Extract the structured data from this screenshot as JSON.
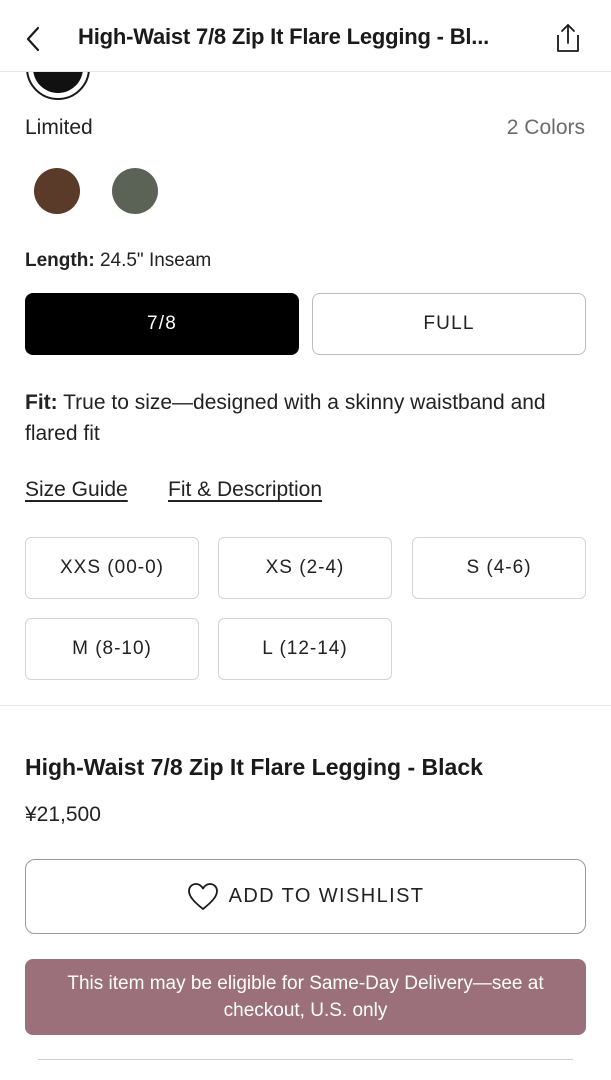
{
  "header": {
    "title": "High-Waist 7/8 Zip It Flare Legging - Bl...",
    "back_icon": "chevron-left-icon",
    "share_icon": "share-icon"
  },
  "colors": {
    "limited_label": "Limited",
    "count_label": "2 Colors",
    "selected_swatch_color": "#111111",
    "swatches": [
      {
        "name": "brown",
        "color": "#5a3a28"
      },
      {
        "name": "olive",
        "color": "#5a6356"
      }
    ]
  },
  "length": {
    "label": "Length:",
    "value": "24.5\" Inseam",
    "options": [
      {
        "label": "7/8",
        "selected": true
      },
      {
        "label": "FULL",
        "selected": false
      }
    ]
  },
  "fit": {
    "label": "Fit:",
    "text": "True to size—designed with a skinny waistband and flared fit"
  },
  "links": {
    "size_guide": "Size Guide",
    "fit_description": "Fit & Description"
  },
  "sizes": [
    "XXS (00-0)",
    "XS (2-4)",
    "S (4-6)",
    "M (8-10)",
    "L (12-14)"
  ],
  "product": {
    "name": "High-Waist 7/8 Zip It Flare Legging - Black",
    "price": "¥21,500"
  },
  "wishlist": {
    "label": "ADD TO WISHLIST",
    "icon": "heart-icon"
  },
  "delivery": {
    "text": "This item may be eligible for Same-Day Delivery—see at checkout, U.S. only",
    "color": "#9b707a"
  }
}
